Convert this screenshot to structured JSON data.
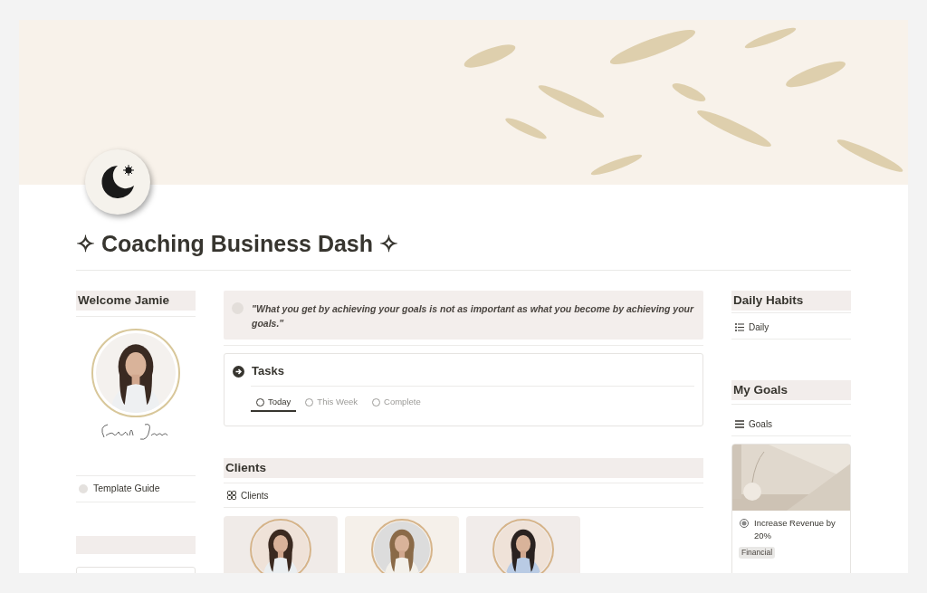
{
  "page": {
    "title": "✧ Coaching Business Dash ✧"
  },
  "left": {
    "heading": "Welcome Jamie",
    "links": [
      {
        "label": "Template Guide"
      }
    ],
    "second_heading": {
      "kind": "empty"
    }
  },
  "quote": {
    "text": "\"What you get by achieving your goals is not as important as what you become by achieving your goals.\""
  },
  "tasks": {
    "title": "Tasks",
    "tabs": [
      {
        "label": "Today",
        "selected": true
      },
      {
        "label": "This Week",
        "selected": false
      },
      {
        "label": "Complete",
        "selected": false
      }
    ]
  },
  "clients": {
    "heading": "Clients",
    "view": "Clients"
  },
  "daily_habits": {
    "heading": "Daily Habits",
    "view": "Daily"
  },
  "goals": {
    "heading": "My Goals",
    "view": "Goals",
    "cards": [
      {
        "title": "Increase Revenue by 20%",
        "tags": [
          {
            "label": "Financial"
          }
        ]
      }
    ]
  }
}
